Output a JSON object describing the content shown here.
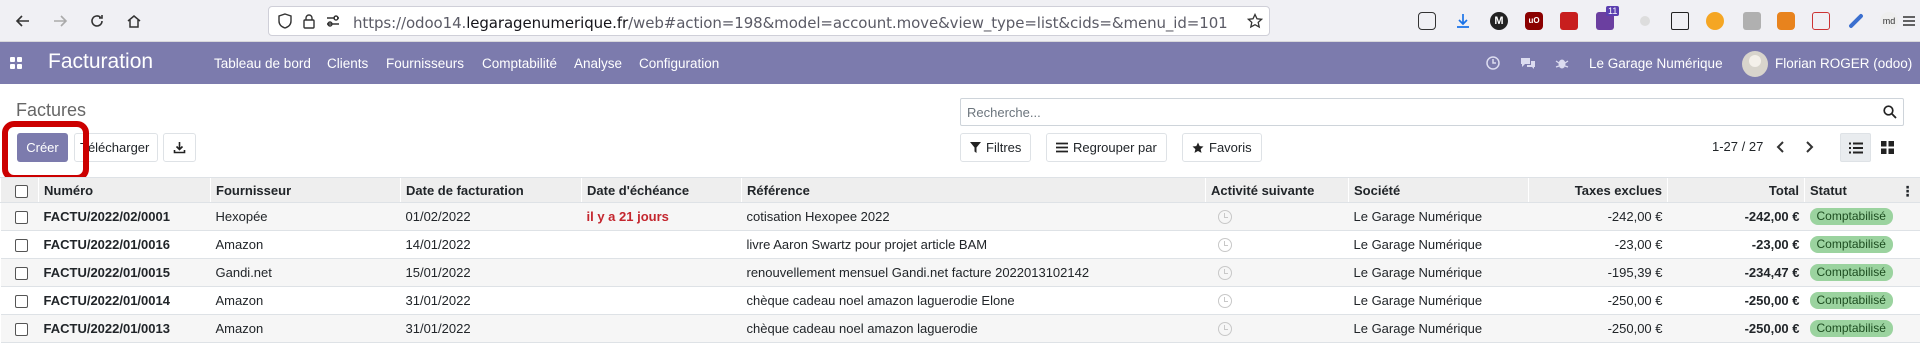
{
  "browser": {
    "url_prefix": "https://odoo14.",
    "url_host": "legaragenumerique.fr",
    "url_suffix": "/web#action=198&model=account.move&view_type=list&cids=&menu_id=101",
    "extension_badge": "11"
  },
  "navbar": {
    "app_name": "Facturation",
    "menu": [
      "Tableau de bord",
      "Clients",
      "Fournisseurs",
      "Comptabilité",
      "Analyse",
      "Configuration"
    ],
    "company": "Le Garage Numérique",
    "user": "Florian ROGER (odoo)"
  },
  "control_panel": {
    "breadcrumb": "Factures",
    "search_placeholder": "Recherche...",
    "create_label": "Créer",
    "upload_label": "Télécharger",
    "filters_label": "Filtres",
    "group_label": "Regrouper par",
    "favorites_label": "Favoris",
    "pager": "1-27 / 27"
  },
  "table": {
    "headers": {
      "numero": "Numéro",
      "fournisseur": "Fournisseur",
      "date_facturation": "Date de facturation",
      "date_echeance": "Date d'échéance",
      "reference": "Référence",
      "activite": "Activité suivante",
      "societe": "Société",
      "taxes_exclues": "Taxes exclues",
      "total": "Total",
      "statut": "Statut"
    },
    "rows": [
      {
        "numero": "FACTU/2022/02/0001",
        "fournisseur": "Hexopée",
        "date_facturation": "01/02/2022",
        "date_echeance": "il y a 21 jours",
        "reference": "cotisation Hexopee 2022",
        "societe": "Le Garage Numérique",
        "taxes_exclues": "-242,00 €",
        "total": "-242,00 €",
        "statut": "Comptabilisé"
      },
      {
        "numero": "FACTU/2022/01/0016",
        "fournisseur": "Amazon",
        "date_facturation": "14/01/2022",
        "date_echeance": "",
        "reference": "livre Aaron Swartz pour projet article BAM",
        "societe": "Le Garage Numérique",
        "taxes_exclues": "-23,00 €",
        "total": "-23,00 €",
        "statut": "Comptabilisé"
      },
      {
        "numero": "FACTU/2022/01/0015",
        "fournisseur": "Gandi.net",
        "date_facturation": "15/01/2022",
        "date_echeance": "",
        "reference": "renouvellement mensuel Gandi.net facture 2022013102142",
        "societe": "Le Garage Numérique",
        "taxes_exclues": "-195,39 €",
        "total": "-234,47 €",
        "statut": "Comptabilisé"
      },
      {
        "numero": "FACTU/2022/01/0014",
        "fournisseur": "Amazon",
        "date_facturation": "31/01/2022",
        "date_echeance": "",
        "reference": "chèque cadeau noel amazon laguerodie Elone",
        "societe": "Le Garage Numérique",
        "taxes_exclues": "-250,00 €",
        "total": "-250,00 €",
        "statut": "Comptabilisé"
      },
      {
        "numero": "FACTU/2022/01/0013",
        "fournisseur": "Amazon",
        "date_facturation": "31/01/2022",
        "date_echeance": "",
        "reference": "chèque cadeau noel amazon laguerodie",
        "societe": "Le Garage Numérique",
        "taxes_exclues": "-250,00 €",
        "total": "-250,00 €",
        "statut": "Comptabilisé"
      }
    ]
  },
  "colors": {
    "navbar": "#7c7bad",
    "primary_button": "#7c7bad",
    "highlight": "#cc0000",
    "status_badge": "#9bd39f",
    "late_date": "#c4262e"
  }
}
